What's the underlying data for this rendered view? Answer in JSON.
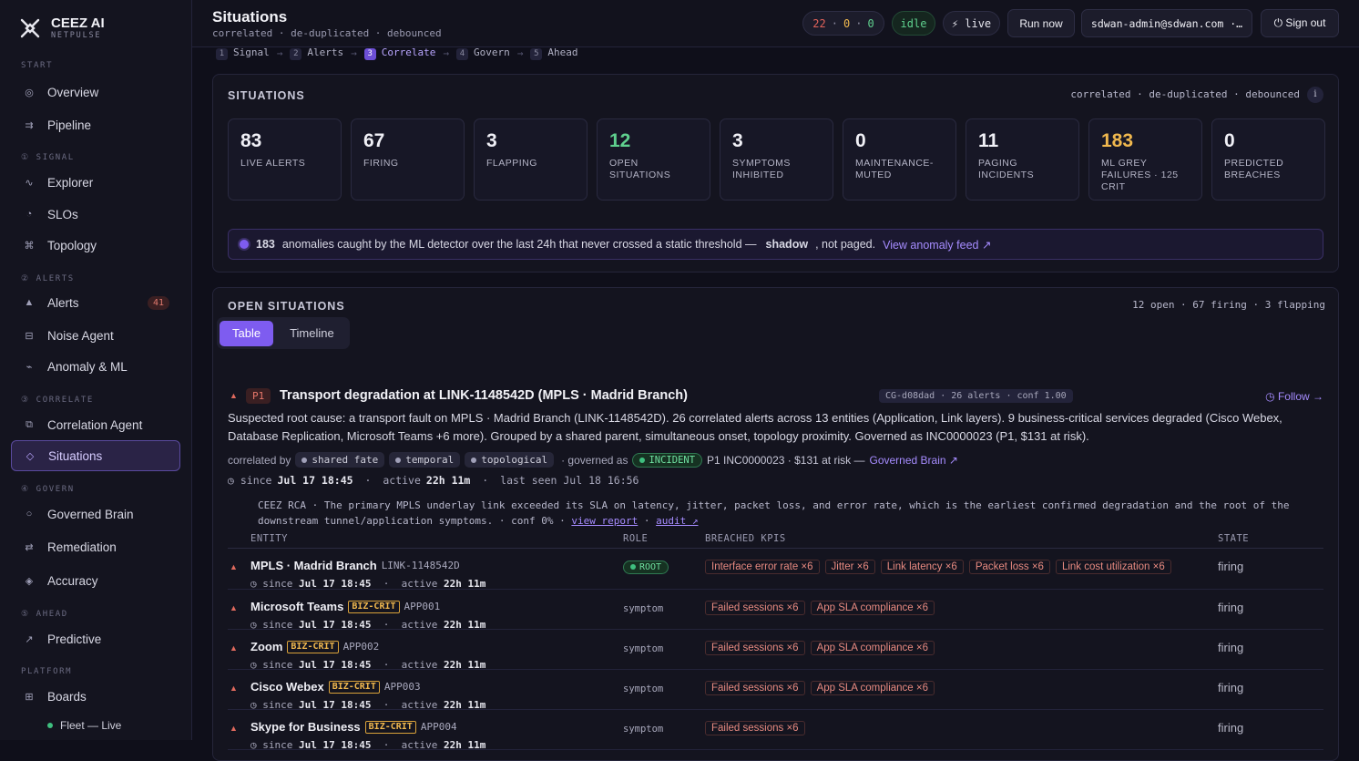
{
  "brand": {
    "name": "CEEZ AI",
    "sub": "NETPULSE"
  },
  "sidebar": {
    "sections": [
      "START",
      "① SIGNAL",
      "② ALERTS",
      "③ CORRELATE",
      "④ GOVERN",
      "⑤ AHEAD",
      "PLATFORM"
    ],
    "items": [
      {
        "label": "Overview",
        "icon": "target-icon",
        "glyph": "◎"
      },
      {
        "label": "Pipeline",
        "icon": "pipeline-icon",
        "glyph": "⇉"
      },
      {
        "label": "Explorer",
        "icon": "wave-icon",
        "glyph": "∿"
      },
      {
        "label": "SLOs",
        "icon": "gauge-icon",
        "glyph": "◔"
      },
      {
        "label": "Topology",
        "icon": "network-icon",
        "glyph": "⌘"
      },
      {
        "label": "Alerts",
        "icon": "alert-icon",
        "glyph": "▲",
        "badge": "41"
      },
      {
        "label": "Noise Agent",
        "icon": "filter-icon",
        "glyph": "⊟"
      },
      {
        "label": "Anomaly & ML",
        "icon": "spark-icon",
        "glyph": "⌁"
      },
      {
        "label": "Correlation Agent",
        "icon": "layers-icon",
        "glyph": "⧉"
      },
      {
        "label": "Situations",
        "icon": "diamond-icon",
        "glyph": "◇"
      },
      {
        "label": "Governed Brain",
        "icon": "circle-icon",
        "glyph": "○"
      },
      {
        "label": "Remediation",
        "icon": "swap-icon",
        "glyph": "⇄"
      },
      {
        "label": "Accuracy",
        "icon": "accuracy-icon",
        "glyph": "◈"
      },
      {
        "label": "Predictive",
        "icon": "trend-icon",
        "glyph": "↗"
      },
      {
        "label": "Boards",
        "icon": "grid-icon",
        "glyph": "⊞"
      }
    ],
    "sub_item": "Fleet — Live"
  },
  "topbar": {
    "title": "Situations",
    "subtitle": "correlated · de-duplicated · debounced",
    "counts": {
      "red": "22",
      "amber": "0",
      "green": "0",
      "sep": "·"
    },
    "status": "idle",
    "live": "⚡ live",
    "run_now": "Run now",
    "user": "sdwan-admin@sdwan.com ·…",
    "sign_out": "⏻ Sign out"
  },
  "crumbs": [
    {
      "n": "1",
      "label": "Signal"
    },
    {
      "n": "2",
      "label": "Alerts"
    },
    {
      "n": "3",
      "label": "Correlate"
    },
    {
      "n": "4",
      "label": "Govern"
    },
    {
      "n": "5",
      "label": "Ahead"
    }
  ],
  "situations_panel": {
    "title": "SITUATIONS",
    "right": "correlated · de-duplicated · debounced",
    "info": "i",
    "cards": [
      {
        "value": "83",
        "label": "LIVE ALERTS",
        "color": "#f0f0f6"
      },
      {
        "value": "67",
        "label": "FIRING",
        "color": "#f0f0f6"
      },
      {
        "value": "3",
        "label": "FLAPPING",
        "color": "#f0f0f6"
      },
      {
        "value": "12",
        "label": "OPEN SITUATIONS",
        "color": "#5fd08e"
      },
      {
        "value": "3",
        "label": "SYMPTOMS INHIBITED",
        "color": "#f0f0f6"
      },
      {
        "value": "0",
        "label": "MAINTENANCE-MUTED",
        "color": "#f0f0f6"
      },
      {
        "value": "11",
        "label": "PAGING INCIDENTS",
        "color": "#f0f0f6"
      },
      {
        "value": "183",
        "label": "ML GREY FAILURES · 125 CRIT",
        "color": "#f0b84e"
      },
      {
        "value": "0",
        "label": "PREDICTED BREACHES",
        "color": "#f0f0f6"
      }
    ],
    "banner": {
      "count": "183",
      "text": "anomalies caught by the ML detector over the last 24h that never crossed a static threshold —",
      "bold": "shadow",
      "tail": ", not paged.",
      "link": "View anomaly feed ↗"
    }
  },
  "open_panel": {
    "title": "OPEN SITUATIONS",
    "right": "12 open · 67 firing · 3 flapping",
    "tabs": [
      "Table",
      "Timeline"
    ],
    "situation": {
      "priority": "P1",
      "title": "Transport degradation at LINK-1148542D (MPLS · Madrid Branch)",
      "meta": "CG-d08dad · 26 alerts · conf 1.00",
      "follow": "◷ Follow →",
      "summary": "Suspected root cause: a transport fault on MPLS · Madrid Branch (LINK-1148542D). 26 correlated alerts across 13 entities (Application, Link layers). 9 business-critical services degraded (Cisco Webex, Database Replication, Microsoft Teams +6 more). Grouped by a shared parent, simultaneous onset, topology proximity. Governed as INC0000023 (P1, $131 at risk).",
      "correlated_by": "correlated by",
      "chips": [
        "shared fate",
        "temporal",
        "topological"
      ],
      "governed_as": "· governed as",
      "incident": "INCIDENT",
      "incident_tail": "P1 INC0000023 · $131 at risk —",
      "governed_link": "Governed Brain ↗",
      "since_label": "◷ since",
      "since": "Jul 17 18:45",
      "active_label": "active",
      "active": "22h 11m",
      "last_seen": "last seen Jul 18 16:56",
      "rca": "CEEZ RCA · The primary MPLS underlay link exceeded its SLA on latency, jitter, packet loss, and error rate, which is the earliest confirmed degradation and the root of the downstream tunnel/application symptoms. · conf 0% ·",
      "view_report": "view report",
      "audit": "audit ↗",
      "columns": [
        "ENTITY",
        "ROLE",
        "BREACHED KPIS",
        "STATE"
      ],
      "rows": [
        {
          "entity": "MPLS · Madrid Branch",
          "id": "LINK-1148542D",
          "biz": "",
          "role": "ROOT",
          "kpis": [
            "Interface error rate ×6",
            "Jitter ×6",
            "Link latency ×6",
            "Packet loss ×6",
            "Link cost utilization ×6"
          ],
          "state": "firing",
          "since": "Jul 17 18:45",
          "active": "22h 11m"
        },
        {
          "entity": "Microsoft Teams",
          "id": "APP001",
          "biz": "BIZ-CRIT",
          "role": "symptom",
          "kpis": [
            "Failed sessions ×6",
            "App SLA compliance ×6"
          ],
          "state": "firing",
          "since": "Jul 17 18:45",
          "active": "22h 11m"
        },
        {
          "entity": "Zoom",
          "id": "APP002",
          "biz": "BIZ-CRIT",
          "role": "symptom",
          "kpis": [
            "Failed sessions ×6",
            "App SLA compliance ×6"
          ],
          "state": "firing",
          "since": "Jul 17 18:45",
          "active": "22h 11m"
        },
        {
          "entity": "Cisco Webex",
          "id": "APP003",
          "biz": "BIZ-CRIT",
          "role": "symptom",
          "kpis": [
            "Failed sessions ×6",
            "App SLA compliance ×6"
          ],
          "state": "firing",
          "since": "Jul 17 18:45",
          "active": "22h 11m"
        },
        {
          "entity": "Skype for Business",
          "id": "APP004",
          "biz": "BIZ-CRIT",
          "role": "symptom",
          "kpis": [
            "Failed sessions ×6"
          ],
          "state": "firing",
          "since": "Jul 17 18:45",
          "active": "22h 11m"
        }
      ]
    }
  }
}
